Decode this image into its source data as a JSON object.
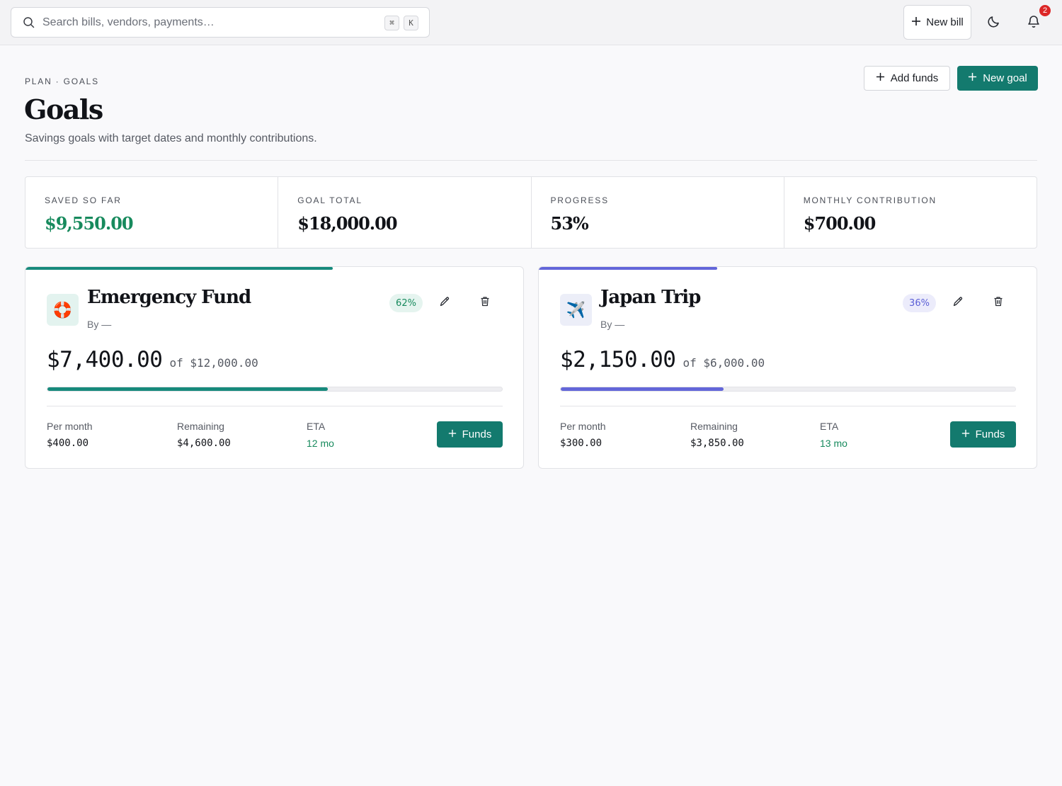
{
  "topbar": {
    "search_placeholder": "Search bills, vendors, payments…",
    "shortcut_keys": [
      "⌘",
      "K"
    ],
    "new_bill_label": "New bill",
    "notification_count": "2",
    "icons": [
      "search-icon",
      "plus-icon",
      "moon-icon",
      "bell-icon"
    ]
  },
  "header": {
    "breadcrumb": "PLAN · GOALS",
    "title": "Goals",
    "subtitle": "Savings goals with target dates and monthly contributions.",
    "add_funds_label": "Add funds",
    "new_goal_label": "New goal"
  },
  "stats": [
    {
      "label": "SAVED SO FAR",
      "value": "$9,550.00"
    },
    {
      "label": "GOAL TOTAL",
      "value": "$18,000.00"
    },
    {
      "label": "PROGRESS",
      "value": "53%"
    },
    {
      "label": "MONTHLY CONTRIBUTION",
      "value": "$700.00"
    }
  ],
  "goals": [
    {
      "emoji": "🛟",
      "name": "Emergency Fund",
      "by": "By —",
      "percent_label": "62%",
      "progress": 0.6167,
      "saved": "$7,400.00",
      "target_text": "of $12,000.00",
      "per_month_label": "Per month",
      "per_month": "$400.00",
      "remaining_label": "Remaining",
      "remaining": "$4,600.00",
      "eta_label": "ETA",
      "eta": "12 mo",
      "funds_label": "Funds",
      "accent_color": "#178a7c",
      "badge_bg": "#e5f4ef",
      "badge_color": "#178a5d",
      "icon_bg": "#e3f3ef"
    },
    {
      "emoji": "✈️",
      "name": "Japan Trip",
      "by": "By —",
      "percent_label": "36%",
      "progress": 0.3583,
      "saved": "$2,150.00",
      "target_text": "of $6,000.00",
      "per_month_label": "Per month",
      "per_month": "$300.00",
      "remaining_label": "Remaining",
      "remaining": "$3,850.00",
      "eta_label": "ETA",
      "eta": "13 mo",
      "funds_label": "Funds",
      "accent_color": "#6366d9",
      "badge_bg": "#ececfb",
      "badge_color": "#5b5fd6",
      "icon_bg": "#eceef8"
    }
  ],
  "colors": {
    "primary": "#137a6e",
    "positive": "#178a5d",
    "danger_badge": "#dc2626"
  }
}
